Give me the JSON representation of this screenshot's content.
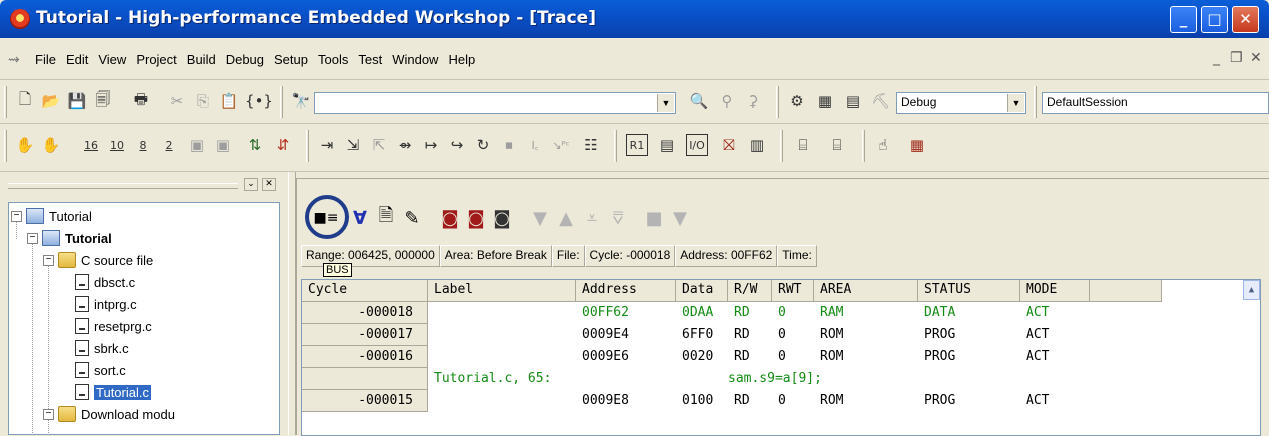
{
  "window": {
    "title": "Tutorial - High-performance Embedded Workshop - [Trace]"
  },
  "menu": [
    "File",
    "Edit",
    "View",
    "Project",
    "Build",
    "Debug",
    "Setup",
    "Tools",
    "Test",
    "Window",
    "Help"
  ],
  "toolbar1": {
    "search_value": "",
    "config_combo": "Debug",
    "session_combo": "DefaultSession"
  },
  "toolbar2": {
    "buttons": [
      "16",
      "10",
      "8",
      "2"
    ]
  },
  "workspace": {
    "tree": [
      {
        "label": "Tutorial",
        "bold": false
      },
      {
        "label": "Tutorial",
        "bold": true
      },
      {
        "label": "C source file"
      },
      {
        "label": "dbsct.c"
      },
      {
        "label": "intprg.c"
      },
      {
        "label": "resetprg.c"
      },
      {
        "label": "sbrk.c"
      },
      {
        "label": "sort.c"
      },
      {
        "label": "Tutorial.c",
        "selected": true
      },
      {
        "label": "Download modu"
      }
    ]
  },
  "trace": {
    "info": {
      "range": "Range: 006425, 000000",
      "area": "Area: Before Break",
      "file": "File:",
      "cycle": "Cycle: -000018",
      "address": "Address: 00FF62",
      "time": "Time:"
    },
    "tooltip": "BUS",
    "columns": [
      "Cycle",
      "Label",
      "Address",
      "Data",
      "R/W",
      "RWT",
      "AREA",
      "STATUS",
      "MODE"
    ],
    "rows": [
      {
        "cycle": "-000018",
        "label": "",
        "address": "00FF62",
        "data": "0DAA",
        "rw": "RD",
        "rwt": "0",
        "area": "RAM",
        "status": "DATA",
        "mode": "ACT",
        "highlight": true
      },
      {
        "cycle": "-000017",
        "label": "",
        "address": "0009E4",
        "data": "6FF0",
        "rw": "RD",
        "rwt": "0",
        "area": "ROM",
        "status": "PROG",
        "mode": "ACT"
      },
      {
        "cycle": "-000016",
        "label": "",
        "address": "0009E6",
        "data": "0020",
        "rw": "RD",
        "rwt": "0",
        "area": "ROM",
        "status": "PROG",
        "mode": "ACT"
      },
      {
        "source_file": "Tutorial.c, 65:",
        "source_code": "sam.s9=a[9];"
      },
      {
        "cycle": "-000015",
        "label": "",
        "address": "0009E8",
        "data": "0100",
        "rw": "RD",
        "rwt": "0",
        "area": "ROM",
        "status": "PROG",
        "mode": "ACT"
      }
    ]
  }
}
